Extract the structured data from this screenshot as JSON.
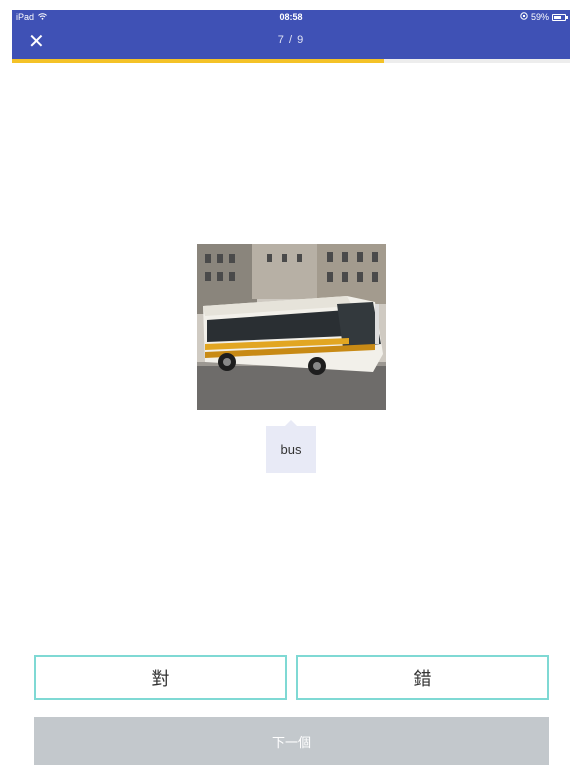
{
  "status_bar": {
    "device": "iPad",
    "time": "08:58",
    "battery": "59%"
  },
  "header": {
    "counter": "7 / 9",
    "progress_fraction": 0.667
  },
  "card": {
    "image_icon": "bus-photo",
    "word": "bus"
  },
  "answers": {
    "correct_label": "對",
    "wrong_label": "錯"
  },
  "footer": {
    "next_label": "下一個"
  },
  "colors": {
    "header_bg": "#3f51b5",
    "progress": "#f4c227",
    "answer_border": "#7fd9d4",
    "next_bg": "#c3c8cc"
  }
}
